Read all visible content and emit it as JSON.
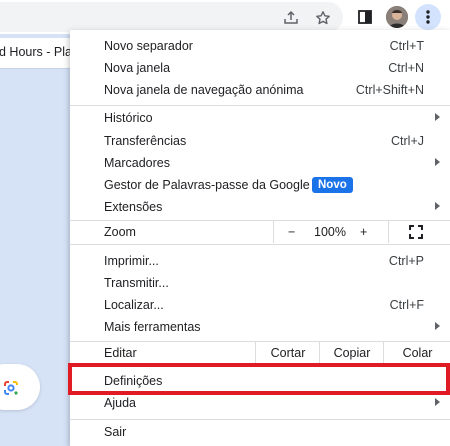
{
  "page": {
    "tab_title": "d Hours - Pla..."
  },
  "toolbar": {
    "share_icon": "share-icon",
    "bookmark_icon": "star-icon",
    "sidepanel_icon": "side-panel-icon",
    "menu_icon": "kebab-menu-icon"
  },
  "menu": {
    "group1": [
      {
        "label": "Novo separador",
        "shortcut": "Ctrl+T"
      },
      {
        "label": "Nova janela",
        "shortcut": "Ctrl+N"
      },
      {
        "label": "Nova janela de navegação anónima",
        "shortcut": "Ctrl+Shift+N"
      }
    ],
    "group2": [
      {
        "label": "Histórico",
        "shortcut": ""
      },
      {
        "label": "Transferências",
        "shortcut": "Ctrl+J"
      },
      {
        "label": "Marcadores",
        "shortcut": ""
      },
      {
        "label": "Gestor de Palavras-passe da Google",
        "shortcut": "",
        "badge": "Novo"
      },
      {
        "label": "Extensões",
        "shortcut": ""
      }
    ],
    "zoom": {
      "label": "Zoom",
      "minus": "−",
      "value": "100%",
      "plus": "+"
    },
    "group3": [
      {
        "label": "Imprimir...",
        "shortcut": "Ctrl+P"
      },
      {
        "label": "Transmitir...",
        "shortcut": ""
      },
      {
        "label": "Localizar...",
        "shortcut": "Ctrl+F"
      },
      {
        "label": "Mais ferramentas",
        "shortcut": ""
      }
    ],
    "edit": {
      "label": "Editar",
      "cut": "Cortar",
      "copy": "Copiar",
      "paste": "Colar"
    },
    "group4": [
      {
        "label": "Definições"
      },
      {
        "label": "Ajuda"
      }
    ],
    "exit": {
      "label": "Sair"
    }
  },
  "colors": {
    "accent": "#1a73e8",
    "highlight": "#e01b24",
    "page_background": "#d6e3f7"
  }
}
